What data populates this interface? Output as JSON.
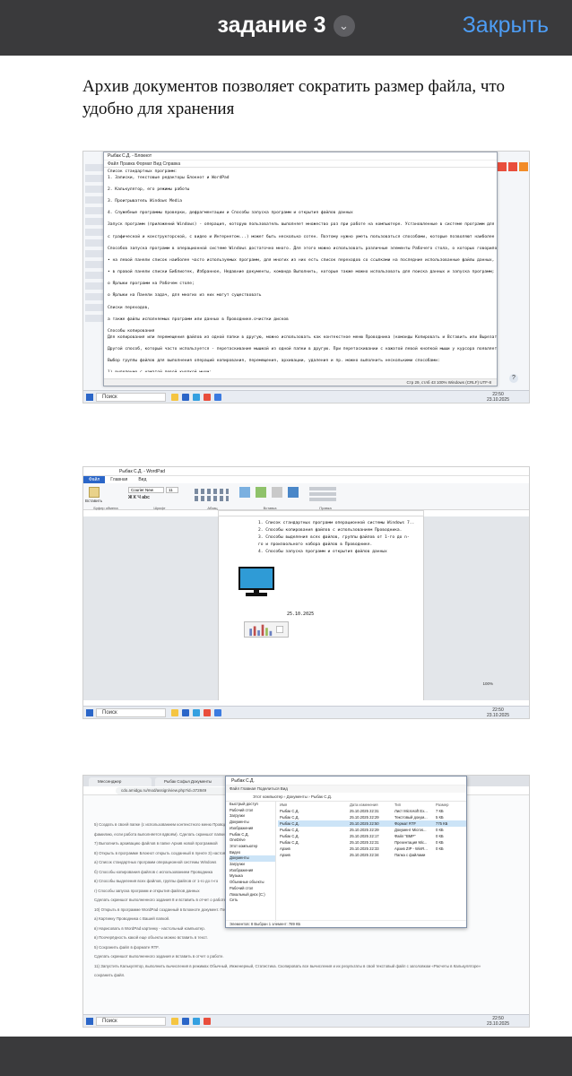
{
  "header": {
    "title": "задание 3",
    "close_label": "Закрыть"
  },
  "question": "Архив документов позволяет сократить размер файла, что удобно для хранения",
  "notepad": {
    "title": "Рыбак С.Д. - Блокнот",
    "menu": "Файл  Правка  Формат  Вид  Справка",
    "lines": [
      "Список стандартных программ:",
      " 1. Записки, текстовые редакторы Блокнот и WordPad",
      "",
      "2. Калькулятор, его режимы работы",
      "",
      "3. Проигрыватель Windows Media",
      "",
      "4. Служебные программы проверки, дефрагментации и Способы запуска программ и открытия файлов данных",
      "",
      "Запуск программ (приложений Windows) - операция, которую пользователь выполняет множество раз при работе на компьютере. Установленные в системе программ для работы с различ",
      "",
      "с графической и конструкторской, с видео и Интернетом...) может быть несколько сотен. Поэтому нужно уметь пользоваться способами, которые позволяют наиболее быстро найти и",
      "",
      "Способов запуска программ в операционной системе Windows достаточно много. Для этого можно использовать различные элементы Рабочего стола, о которых говорилось в предыдущем",
      "",
      "• на левой панели список наиболее часто используемых программ, для многих из них есть список переходов со ссылками на последние использованные файлы данных, а внизу кнопку",
      "",
      "• в правой панели списки Библиотек, Избранное, Недавние документы, команда Выполнить, которые также можно использовать для поиска данных и запуска программ;",
      "",
      "о Ярлыки программ на Рабочем столе;",
      "",
      "о Ярлыки на Панели задач, для многих из них могут существовать",
      "",
      "Списки переходов,",
      "",
      "а также файлы исполняемых программ или данных в Проводнике.очистки дисков",
      "",
      "Способы копирования",
      "Для копирования или перемещения файлов из одной папки в другую, можно использовать как контекстное меню Проводника (команды Копировать и Вставить или Вырезать и Вставить),",
      "",
      "Другой способ, который часто используется - перетаскивание мышкой из одной папки в другую. При перетаскивании с нажатой левой кнопкой мыши у курсора появляется сообщение о",
      "",
      "Выбор группы файлов для выполнения операций копирования, перемещения, архивации, удаления и пр. можно выполнить несколькими способами:",
      "",
      "1) выделение с нажатой левой кнопкой мыши;",
      "",
      "2) выделение первого и последнего файлов щелчком мыши с нажатой клавишей SHIFT;",
      "",
      "3) выделение любых файлов в Проводнике при нажатой кнопке CTRL."
    ],
    "status": "Стр 29, стлб 43     100%     Windows (CRLF)     UTF-8",
    "taskbar_search": "Поиск",
    "clock_time": "22:50",
    "clock_date": "23.10.2025"
  },
  "wordpad": {
    "title": "Рыбак С.Д. - WordPad",
    "tabs": [
      "Файл",
      "Главная",
      "Вид"
    ],
    "ribbon_groups": [
      "Буфер обмена",
      "Шрифт",
      "Абзац",
      "Вставка",
      "Правка"
    ],
    "font_name": "Courier New",
    "font_size": "11",
    "paste_label": "Вставить",
    "lines": [
      "1. Список стандартных программ операционной системы Windows 7..",
      "2. Способы копирования файлов с использованием Проводника.",
      "3. Способы выделения всех файлов, группы файлов от 1-го до n-",
      "го и произвольного набора файлов в Проводнике.",
      "4. Способы запуска программ и открытия файлов данных"
    ],
    "date": "25.10.2025",
    "zoom": "100%",
    "taskbar_search": "Поиск",
    "clock_time": "22:50",
    "clock_date": "23.10.2025"
  },
  "browser": {
    "tab1": "Мессенджер",
    "tab2": "Рыбак Софья Документы",
    "url": "cdo.amidgu.ru/mod/assign/view.php?id=372849",
    "lines": [
      "5) Создать в своей папке (с использованием контекстного меню Проводника) текстовые документы",
      "фамилию, если работа выполняется вдвоём). Сделать скриншот папки",
      "7) Выполнить архивацию файлов в папке Архив новой программой",
      "8) Открыть в программе Блокнот открыть созданный в пункте 3) настоящей",
      "а) Список стандартных программ операционной системы Windows",
      "б) Способы копирования файлов с использованием Проводника",
      "в) Способы выделения всех файлов, группы файлов от 1-го до n-го",
      "г) Способы запуска программ и открытия файлов данных",
      "Сделать скриншот выполненного задания 8 и вставить в отчет о работе.",
      "10) Открыть в программе WordPad созданный в Блокноте документ. Переоформить списки пунктов 8а - г) в виде нумерованных и маркированных списков. Вставить в текст:",
      "а) Картинку Проводника с Вашей папкой.",
      "в) Нарисовать в WordPad картинку - настольный компьютер.",
      "в) Поочерёдность какой еще объекты можно вставить в текст.",
      "5) Сохранить файл в формате RTF.",
      "Сделать скриншот выполненного задания и вставить в отчет о работе.",
      "11) Запустить Калькулятор, выполнить вычисления в режимах Обычный, Инженерный, Статистика. Скопировать все вычисления и их результаты в свой текстовый файл с заголовком «Расчеты в Калькуляторе»",
      "сохранить файл."
    ]
  },
  "explorer": {
    "title": "Рыбак С.Д.",
    "menu": "Файл   Главная   Поделиться   Вид",
    "path": "Этот компьютер  ›  Документы  ›  Рыбак С.Д.",
    "search_placeholder": "Поиск: Рыбак С.Д.",
    "nav": [
      "Быстрый доступ",
      "Рабочий стол",
      "Загрузки",
      "Документы",
      "Изображения",
      "Рыбак С.Д.",
      "OneDrive",
      "Этот компьютер",
      "Видео",
      "Документы",
      "Загрузки",
      "Изображения",
      "Музыка",
      "Объемные объекты",
      "Рабочий стол",
      "Локальный диск (C:)",
      "Сеть"
    ],
    "columns": [
      "Имя",
      "Дата изменения",
      "Тип",
      "Размер"
    ],
    "files": [
      {
        "name": "Рыбак С.Д.",
        "date": "25.10.2025 22:31",
        "type": "Лист Microsoft Ex...",
        "size": "7 КБ"
      },
      {
        "name": "Рыбак С.Д.",
        "date": "25.10.2025 22:29",
        "type": "Текстовый докум...",
        "size": "5 КБ"
      },
      {
        "name": "Рыбак С.Д.",
        "date": "25.10.2025 22:50",
        "type": "Формат RTF",
        "size": "775 КБ"
      },
      {
        "name": "Рыбак С.Д.",
        "date": "25.10.2025 22:29",
        "type": "Документ Micros...",
        "size": "0 КБ"
      },
      {
        "name": "Рыбак С.Д.",
        "date": "25.10.2025 22:17",
        "type": "Файл \"BMP\"",
        "size": "0 КБ"
      },
      {
        "name": "Рыбак С.Д.",
        "date": "25.10.2025 22:31",
        "type": "Презентация Mic...",
        "size": "0 КБ"
      },
      {
        "name": "Архив",
        "date": "25.10.2025 22:33",
        "type": "Архив ZIP - WinR...",
        "size": "0 КБ"
      },
      {
        "name": "Архив",
        "date": "25.10.2025 22:34",
        "type": "Папка с файлами",
        "size": ""
      }
    ],
    "status": "Элементов: 8    Выбран 1 элемент: 789 КБ",
    "clock_time": "22:50",
    "clock_date": "23.10.2025"
  },
  "colors": {
    "bar_bg": "#3a3a3c",
    "accent": "#4d9df5"
  }
}
